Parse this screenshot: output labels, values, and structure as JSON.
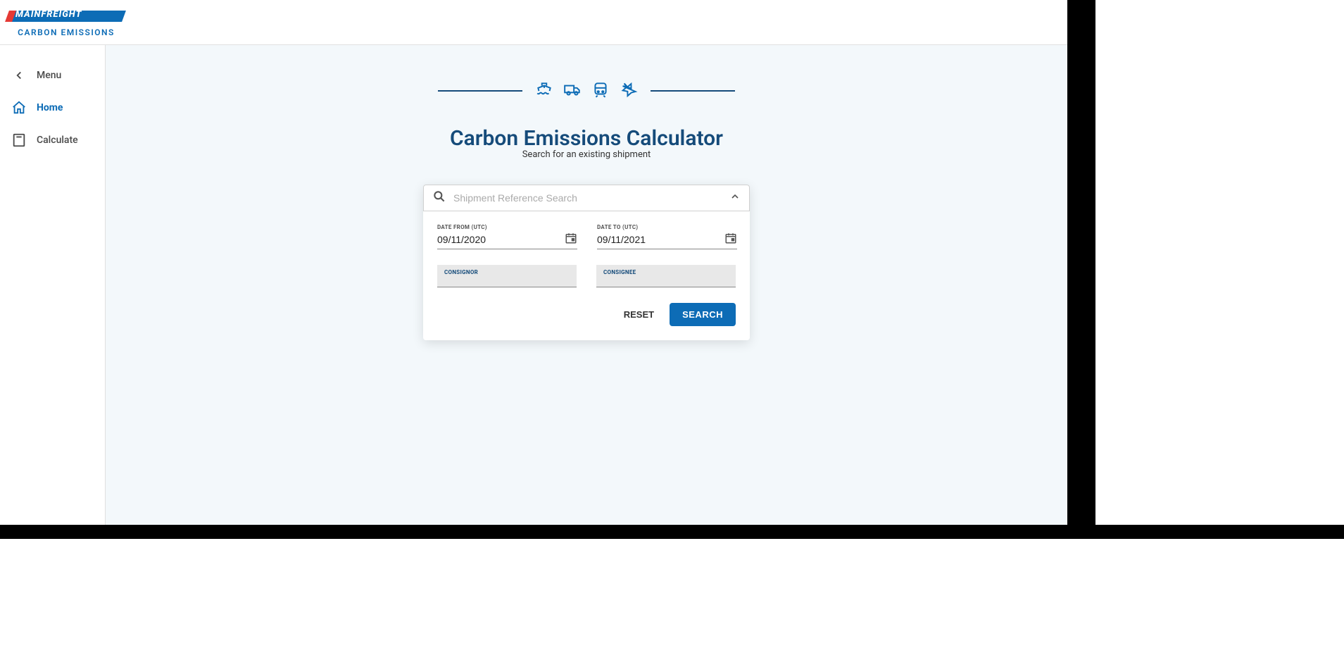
{
  "header": {
    "brand": "MAINFREIGHT",
    "tagline": "CARBON EMISSIONS"
  },
  "sidebar": {
    "menu_label": "Menu",
    "home_label": "Home",
    "calculate_label": "Calculate"
  },
  "hero": {
    "title": "Carbon Emissions Calculator",
    "subtitle": "Search for an existing shipment"
  },
  "search": {
    "placeholder": "Shipment Reference Search",
    "date_from_label": "DATE FROM (UTC)",
    "date_from_value": "09/11/2020",
    "date_to_label": "DATE TO (UTC)",
    "date_to_value": "09/11/2021",
    "consignor_label": "CONSIGNOR",
    "consignee_label": "CONSIGNEE",
    "reset_label": "RESET",
    "search_label": "SEARCH"
  }
}
